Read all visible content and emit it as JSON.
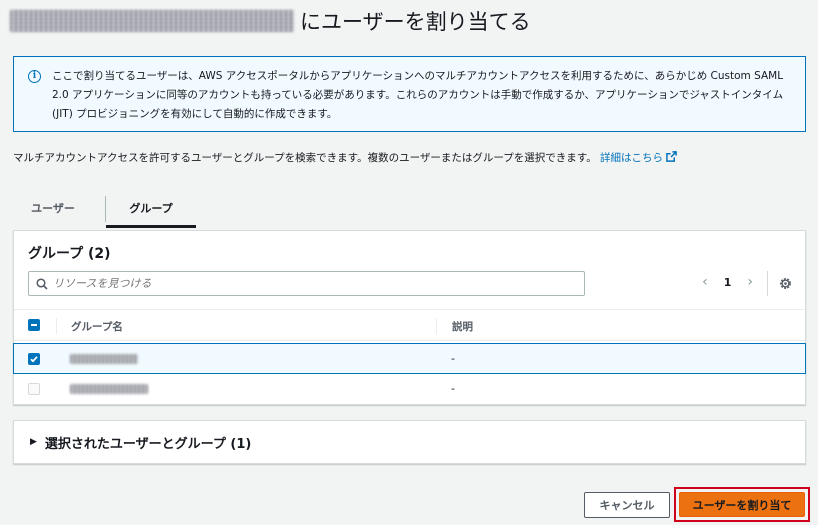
{
  "page": {
    "title_suffix": "にユーザーを割り当てる"
  },
  "info_alert": {
    "text": "ここで割り当てるユーザーは、AWS アクセスポータルからアプリケーションへのマルチアカウントアクセスを利用するために、あらかじめ Custom SAML 2.0 アプリケーションに同等のアカウントも持っている必要があります。これらのアカウントは手動で作成するか、アプリケーションでジャストインタイム (JIT) プロビジョニングを有効にして自動的に作成できます。"
  },
  "description": {
    "text": "マルチアカウントアクセスを許可するユーザーとグループを検索できます。複数のユーザーまたはグループを選択できます。",
    "link": "詳細はこちら"
  },
  "tabs": [
    {
      "label": "ユーザー",
      "active": false
    },
    {
      "label": "グループ",
      "active": true
    }
  ],
  "table": {
    "title": "グループ (2)",
    "search_placeholder": "リソースを見つける",
    "page": "1",
    "columns": {
      "name": "グループ名",
      "description": "説明"
    },
    "rows": [
      {
        "selected": true,
        "description": "-"
      },
      {
        "selected": false,
        "description": "-"
      }
    ]
  },
  "selected_section": {
    "label": "選択されたユーザーとグループ (1)"
  },
  "footer": {
    "cancel": "キャンセル",
    "assign": "ユーザーを割り当て"
  },
  "colors": {
    "primary": "#ec7211",
    "link": "#0073bb",
    "highlight": "#d0021b"
  }
}
